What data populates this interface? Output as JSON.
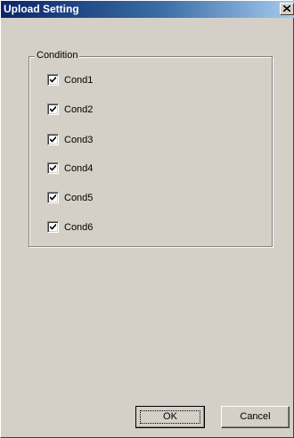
{
  "window": {
    "title": "Upload Setting",
    "close_icon": "close-icon"
  },
  "group": {
    "label": "Condition",
    "conditions": [
      {
        "label": "Cond1",
        "checked": true
      },
      {
        "label": "Cond2",
        "checked": true
      },
      {
        "label": "Cond3",
        "checked": true
      },
      {
        "label": "Cond4",
        "checked": true
      },
      {
        "label": "Cond5",
        "checked": true
      },
      {
        "label": "Cond6",
        "checked": true
      }
    ]
  },
  "buttons": {
    "ok_label": "OK",
    "cancel_label": "Cancel"
  },
  "colors": {
    "title_start": "#0a246a",
    "title_end": "#a6caf0",
    "face": "#d4d0c8"
  }
}
